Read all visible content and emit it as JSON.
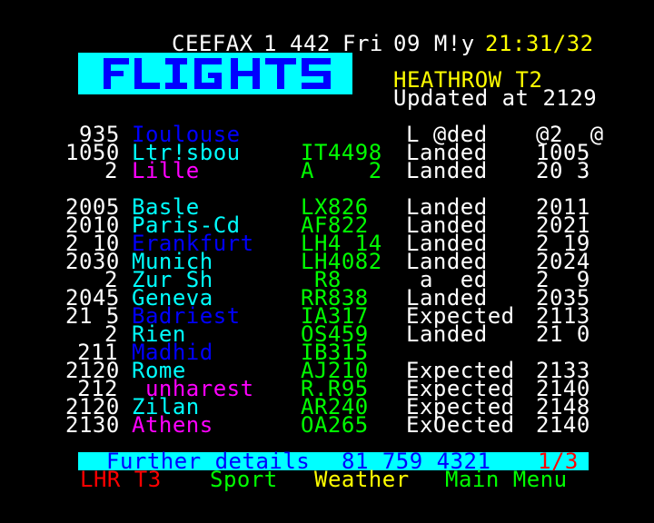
{
  "header": {
    "service": "CEEFAX",
    "channel": "1",
    "page": "442",
    "day": "Fri",
    "date": "09 M!y",
    "time": "21:31/32"
  },
  "banner": {
    "title": "FLIGHTS"
  },
  "subheader": {
    "terminal": "HEATHROW T2",
    "updated": "Updated at 2129"
  },
  "rows": [
    {
      "time": " 935",
      "city": "Ioulouse",
      "city_color": "#0000ff",
      "flight": "",
      "status": "L @ded",
      "actual": "@2  @"
    },
    {
      "time": "1050",
      "city": "Ltr!sbou",
      "city_color": "#00ffff",
      "flight": "IT4498",
      "status": "Landed",
      "actual": "1005"
    },
    {
      "time": "2",
      "city": "Lille",
      "city_color": "#ff00ff",
      "flight": "A    2",
      "status": "Landed",
      "actual": "20 3"
    },
    {
      "time": "",
      "city": "",
      "city_color": "#00ffff",
      "flight": "",
      "status": "",
      "actual": ""
    },
    {
      "time": "2005",
      "city": "Basle",
      "city_color": "#00ffff",
      "flight": "LX826",
      "status": "Landed",
      "actual": "2011"
    },
    {
      "time": "2010",
      "city": "Paris-Cd",
      "city_color": "#00ffff",
      "flight": "AF822",
      "status": "Landed",
      "actual": "2021"
    },
    {
      "time": "2 10",
      "city": "Erankfurt",
      "city_color": "#0000ff",
      "flight": "LH4 14",
      "status": "Landed",
      "actual": "2 19"
    },
    {
      "time": "2030",
      "city": "Munich",
      "city_color": "#00ffff",
      "flight": "LH4082",
      "status": "Landed",
      "actual": "2024"
    },
    {
      "time": "2",
      "city": "Zur Sh",
      "city_color": "#00ffff",
      "flight": " R8",
      "status": " a  ed",
      "actual": "2  9"
    },
    {
      "time": "2045",
      "city": "Geneva",
      "city_color": "#00ffff",
      "flight": "RR838",
      "status": "Landed",
      "actual": "2035"
    },
    {
      "time": "21 5",
      "city": "Badriest",
      "city_color": "#0000ff",
      "flight": "IA317",
      "status": "Expected",
      "actual": "2113"
    },
    {
      "time": "2",
      "city": "Rien",
      "city_color": "#00ffff",
      "flight": "OS459",
      "status": "Landed",
      "actual": "21 0"
    },
    {
      "time": "211",
      "city": "Madhid",
      "city_color": "#0000ff",
      "flight": "IB315",
      "status": "",
      "actual": ""
    },
    {
      "time": "2120",
      "city": "Rome",
      "city_color": "#00ffff",
      "flight": "AJ210",
      "status": "Expected",
      "actual": "2133"
    },
    {
      "time": "212",
      "city": " unharest",
      "city_color": "#ff00ff",
      "flight": "R.R95",
      "status": "Expected",
      "actual": "2140"
    },
    {
      "time": "2120",
      "city": "Zilan",
      "city_color": "#00ffff",
      "flight": "AR240",
      "status": "Expected",
      "actual": "2148"
    },
    {
      "time": "2130",
      "city": "Athens",
      "city_color": "#ff00ff",
      "flight": "OA265",
      "status": "ExOected",
      "actual": "2140"
    }
  ],
  "footer": {
    "details_label": "Further details",
    "details_phone": "81 759 4321",
    "page_indicator": "1/3",
    "fastext": {
      "red": "LHR T3",
      "green": "Sport",
      "yellow": "Weather",
      "cyan": "Main Menu"
    }
  }
}
